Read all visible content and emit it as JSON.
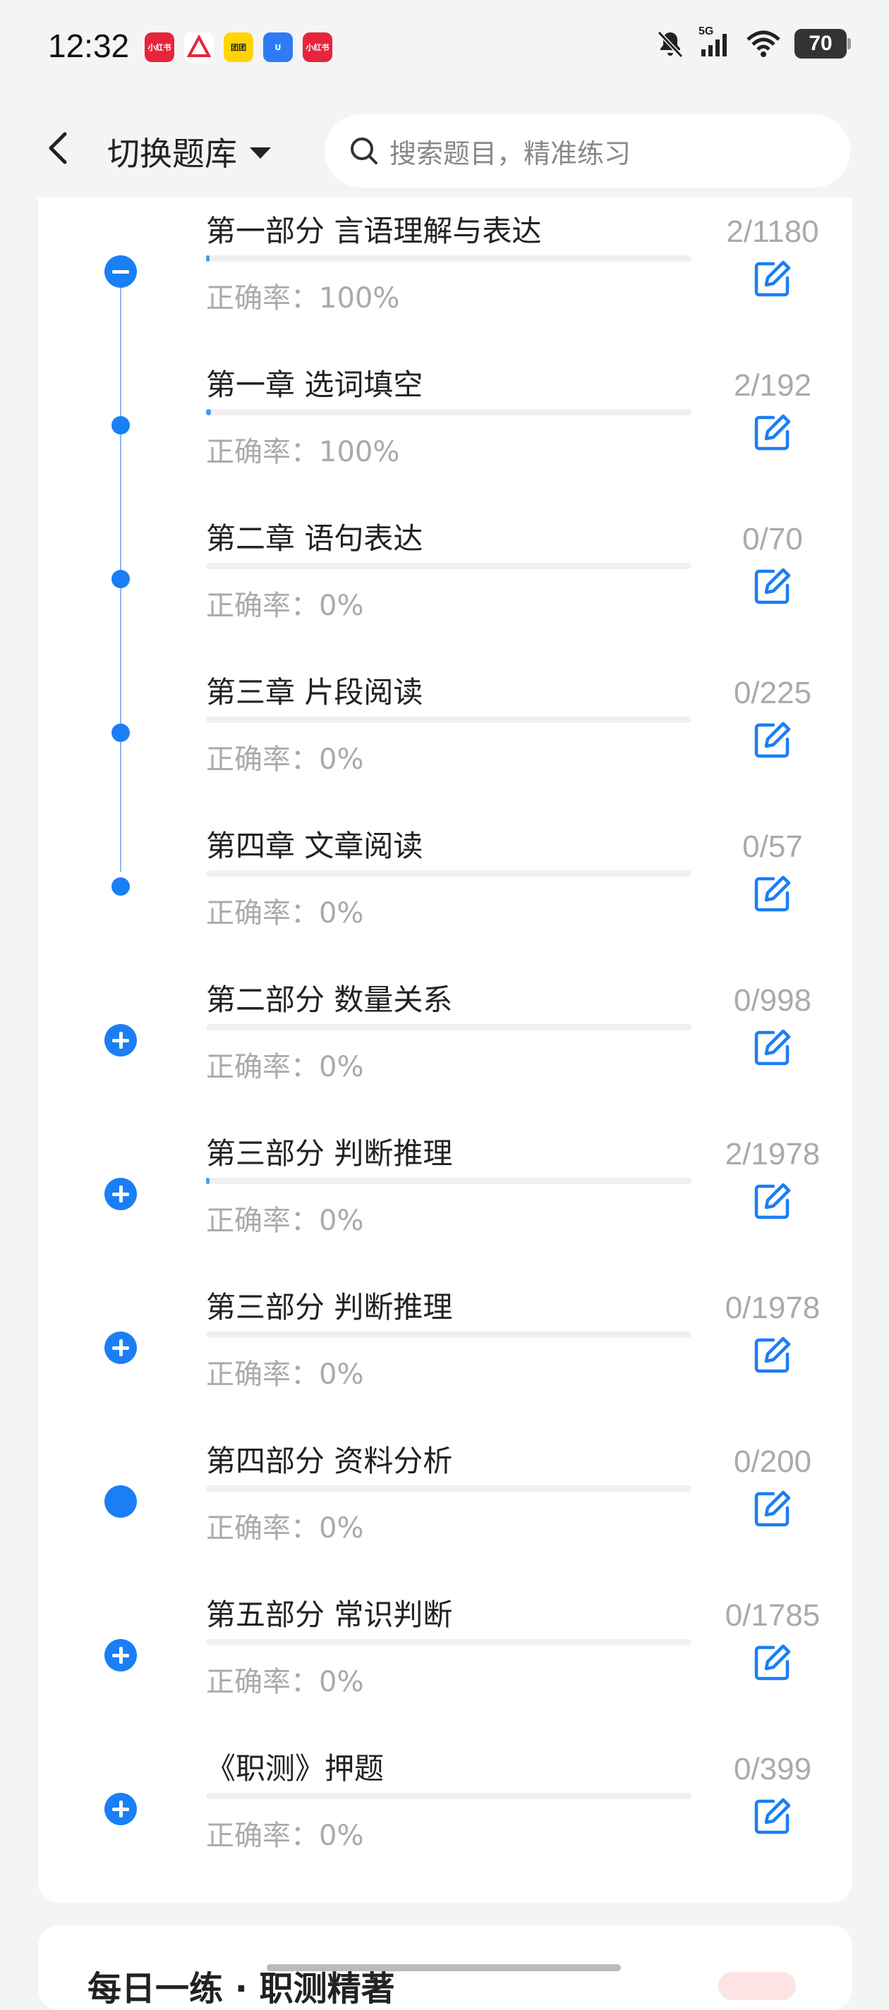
{
  "status_bar": {
    "time": "12:32",
    "app_icons": [
      {
        "name": "xiaohongshu-icon",
        "label": "小红书",
        "color": "#e8243c"
      },
      {
        "name": "triangle-app-icon",
        "label": "",
        "color": "#ffffff"
      },
      {
        "name": "meituan-icon",
        "label": "团团",
        "color": "#ffd400"
      },
      {
        "name": "blue-app-icon",
        "label": "U",
        "color": "#2d7cf6"
      },
      {
        "name": "xiaohongshu-icon-2",
        "label": "小红书",
        "color": "#e8243c"
      }
    ],
    "network": "5G",
    "battery": "70"
  },
  "header": {
    "switch_bank_label": "切换题库",
    "search_placeholder": "搜索题目，精准练习"
  },
  "colors": {
    "accent": "#1a7ef5",
    "progress": "#4a9ae8",
    "muted_text": "#aaaaaa"
  },
  "rows": [
    {
      "title": "第一部分 言语理解与表达",
      "accuracy": "正确率：100%",
      "count": "2/1180",
      "progress": 0.002,
      "node": "minus"
    },
    {
      "title": "第一章 选词填空",
      "accuracy": "正确率：100%",
      "count": "2/192",
      "progress": 0.01,
      "node": "dot"
    },
    {
      "title": "第二章 语句表达",
      "accuracy": "正确率：0%",
      "count": "0/70",
      "progress": 0,
      "node": "dot"
    },
    {
      "title": "第三章 片段阅读",
      "accuracy": "正确率：0%",
      "count": "0/225",
      "progress": 0,
      "node": "dot"
    },
    {
      "title": "第四章 文章阅读",
      "accuracy": "正确率：0%",
      "count": "0/57",
      "progress": 0,
      "node": "dot"
    },
    {
      "title": "第二部分 数量关系",
      "accuracy": "正确率：0%",
      "count": "0/998",
      "progress": 0,
      "node": "plus"
    },
    {
      "title": "第三部分 判断推理",
      "accuracy": "正确率：0%",
      "count": "2/1978",
      "progress": 0.001,
      "node": "plus"
    },
    {
      "title": "第三部分 判断推理",
      "accuracy": "正确率：0%",
      "count": "0/1978",
      "progress": 0,
      "node": "plus"
    },
    {
      "title": "第四部分 资料分析",
      "accuracy": "正确率：0%",
      "count": "0/200",
      "progress": 0,
      "node": "filled"
    },
    {
      "title": "第五部分 常识判断",
      "accuracy": "正确率：0%",
      "count": "0/1785",
      "progress": 0,
      "node": "plus"
    },
    {
      "title": "《职测》押题",
      "accuracy": "正确率：0%",
      "count": "0/399",
      "progress": 0,
      "node": "plus"
    }
  ],
  "next_card": {
    "title": "每日一练 · 职测精著"
  }
}
